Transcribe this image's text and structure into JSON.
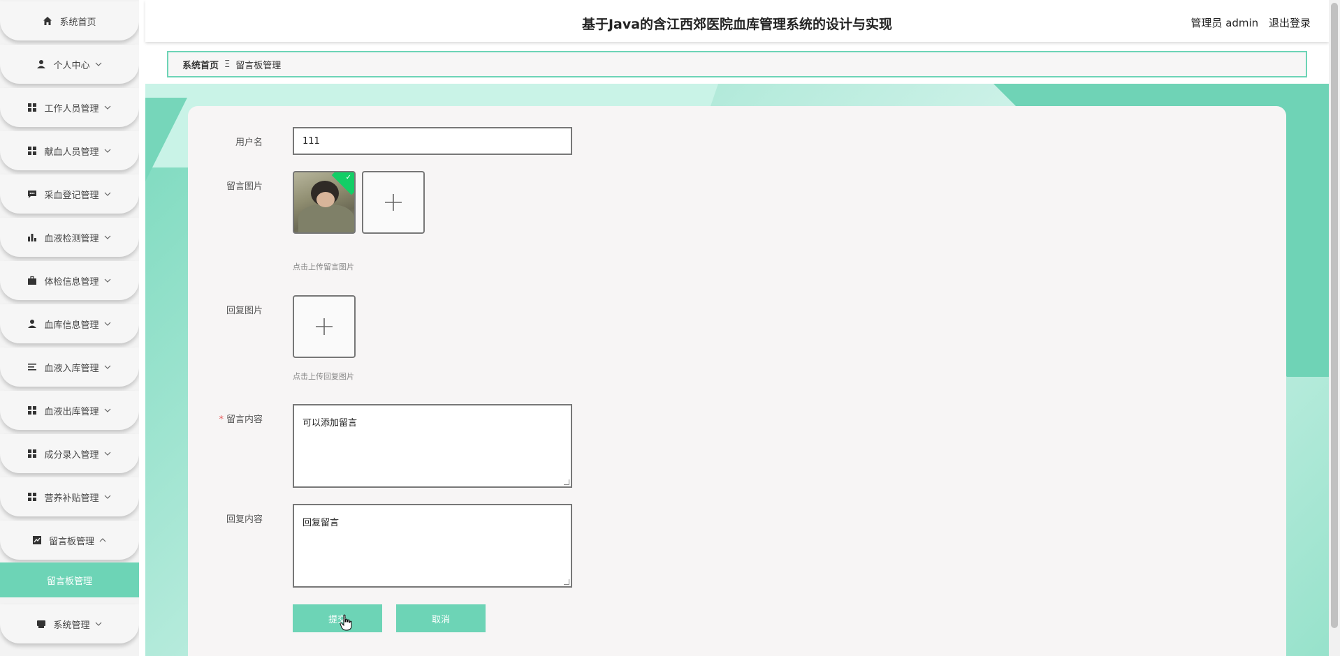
{
  "header": {
    "title": "基于Java的含江西郊医院血库管理系统的设计与实现",
    "user_label": "管理员 admin",
    "logout_label": "退出登录"
  },
  "sidebar": {
    "items": [
      {
        "label": "系统首页",
        "icon": "home-icon"
      },
      {
        "label": "个人中心",
        "icon": "user-icon"
      },
      {
        "label": "工作人员管理",
        "icon": "grid-icon"
      },
      {
        "label": "献血人员管理",
        "icon": "grid-icon"
      },
      {
        "label": "采血登记管理",
        "icon": "chat-icon"
      },
      {
        "label": "血液检测管理",
        "icon": "bar-chart-icon"
      },
      {
        "label": "体检信息管理",
        "icon": "briefcase-icon"
      },
      {
        "label": "血库信息管理",
        "icon": "user-icon"
      },
      {
        "label": "血液入库管理",
        "icon": "list-icon"
      },
      {
        "label": "血液出库管理",
        "icon": "grid-icon"
      },
      {
        "label": "成分录入管理",
        "icon": "grid-icon"
      },
      {
        "label": "营养补贴管理",
        "icon": "grid-icon"
      },
      {
        "label": "留言板管理",
        "icon": "line-chart-icon"
      },
      {
        "label": "系统管理",
        "icon": "printer-icon"
      }
    ],
    "active_sub": "留言板管理"
  },
  "breadcrumb": {
    "home": "系统首页",
    "separator": "Ξ",
    "current": "留言板管理"
  },
  "form": {
    "username_label": "用户名",
    "username_value": "111",
    "msg_image_label": "留言图片",
    "msg_image_hint": "点击上传留言图片",
    "reply_image_label": "回复图片",
    "reply_image_hint": "点击上传回复图片",
    "content_required_mark": "*",
    "content_label": "留言内容",
    "content_value": "可以添加留言",
    "reply_label": "回复内容",
    "reply_value": "回复留言",
    "submit_label": "提交",
    "cancel_label": "取消"
  },
  "colors": {
    "accent": "#6dd4b6",
    "required": "#e65c5c",
    "upload_success": "#13ce66"
  }
}
